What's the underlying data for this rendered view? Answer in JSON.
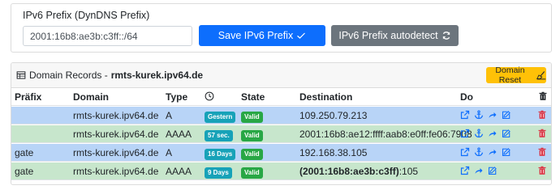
{
  "prefix_section": {
    "label": "IPv6 Prefix (DynDNS Prefix)",
    "input_value": "2001:16b8:ae3b:c3ff::/64",
    "save_button": "Save IPv6 Prefix",
    "autodetect_button": "IPv6 Prefix autodetect"
  },
  "records": {
    "title_prefix": "Domain Records - ",
    "title_domain": "rmts-kurek.ipv64.de",
    "reset_button": "Domain Reset",
    "columns": {
      "prefix": "Präfix",
      "domain": "Domain",
      "type": "Type",
      "state": "State",
      "destination": "Destination",
      "do": "Do"
    },
    "rows": [
      {
        "prefix": "",
        "domain": "rmts-kurek.ipv64.de",
        "type": "A",
        "age": "Gestern",
        "state": "Valid",
        "dest_bold": "",
        "dest": "109.250.79.213",
        "color": "blue"
      },
      {
        "prefix": "",
        "domain": "rmts-kurek.ipv64.de",
        "type": "AAAA",
        "age": "57 sec.",
        "state": "Valid",
        "dest_bold": "",
        "dest": "2001:16b8:ae12:ffff:aab8:e0ff:fe06:7908",
        "color": "green"
      },
      {
        "prefix": "gate",
        "domain": "rmts-kurek.ipv64.de",
        "type": "A",
        "age": "16 Days",
        "state": "Valid",
        "dest_bold": "",
        "dest": "192.168.38.105",
        "color": "blue"
      },
      {
        "prefix": "gate",
        "domain": "rmts-kurek.ipv64.de",
        "type": "AAAA",
        "age": "9 Days",
        "state": "Valid",
        "dest_bold": "(2001:16b8:ae3b:c3ff)",
        "dest": ":105",
        "color": "green"
      }
    ]
  },
  "colors": {
    "primary": "#0d6efd",
    "secondary": "#6c757d",
    "warning": "#ffc107",
    "info": "#17a2b8",
    "success": "#28a745",
    "danger": "#dc3545",
    "row_blue": "#b8d4f7",
    "row_green": "#c7e6cc"
  }
}
